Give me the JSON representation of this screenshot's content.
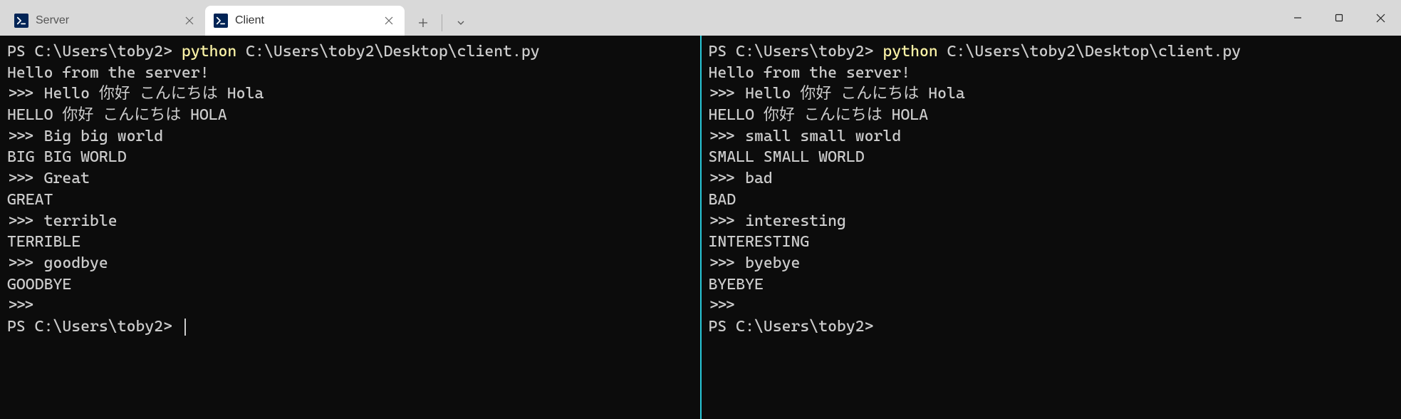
{
  "tabs": [
    {
      "title": "Server",
      "active": false
    },
    {
      "title": "Client",
      "active": true
    }
  ],
  "panes": {
    "left": {
      "prompt1_prefix": "PS C:\\Users\\toby2> ",
      "prompt1_cmd": "python",
      "prompt1_args": " C:\\Users\\toby2\\Desktop\\client.py",
      "lines": [
        "Hello from the server!",
        ">>> Hello 你好 こんにちは Hola",
        "HELLO 你好 こんにちは HOLA",
        ">>> Big big world",
        "BIG BIG WORLD",
        ">>> Great",
        "GREAT",
        ">>> terrible",
        "TERRIBLE",
        ">>> goodbye",
        "GOODBYE",
        ">>> "
      ],
      "prompt2": "PS C:\\Users\\toby2> "
    },
    "right": {
      "prompt1_prefix": "PS C:\\Users\\toby2> ",
      "prompt1_cmd": "python",
      "prompt1_args": " C:\\Users\\toby2\\Desktop\\client.py",
      "lines": [
        "Hello from the server!",
        ">>> Hello 你好 こんにちは Hola",
        "HELLO 你好 こんにちは HOLA",
        ">>> small small world",
        "SMALL SMALL WORLD",
        ">>> bad",
        "BAD",
        ">>> interesting",
        "INTERESTING",
        ">>> byebye",
        "BYEBYE",
        ">>> "
      ],
      "prompt2": "PS C:\\Users\\toby2> "
    }
  }
}
